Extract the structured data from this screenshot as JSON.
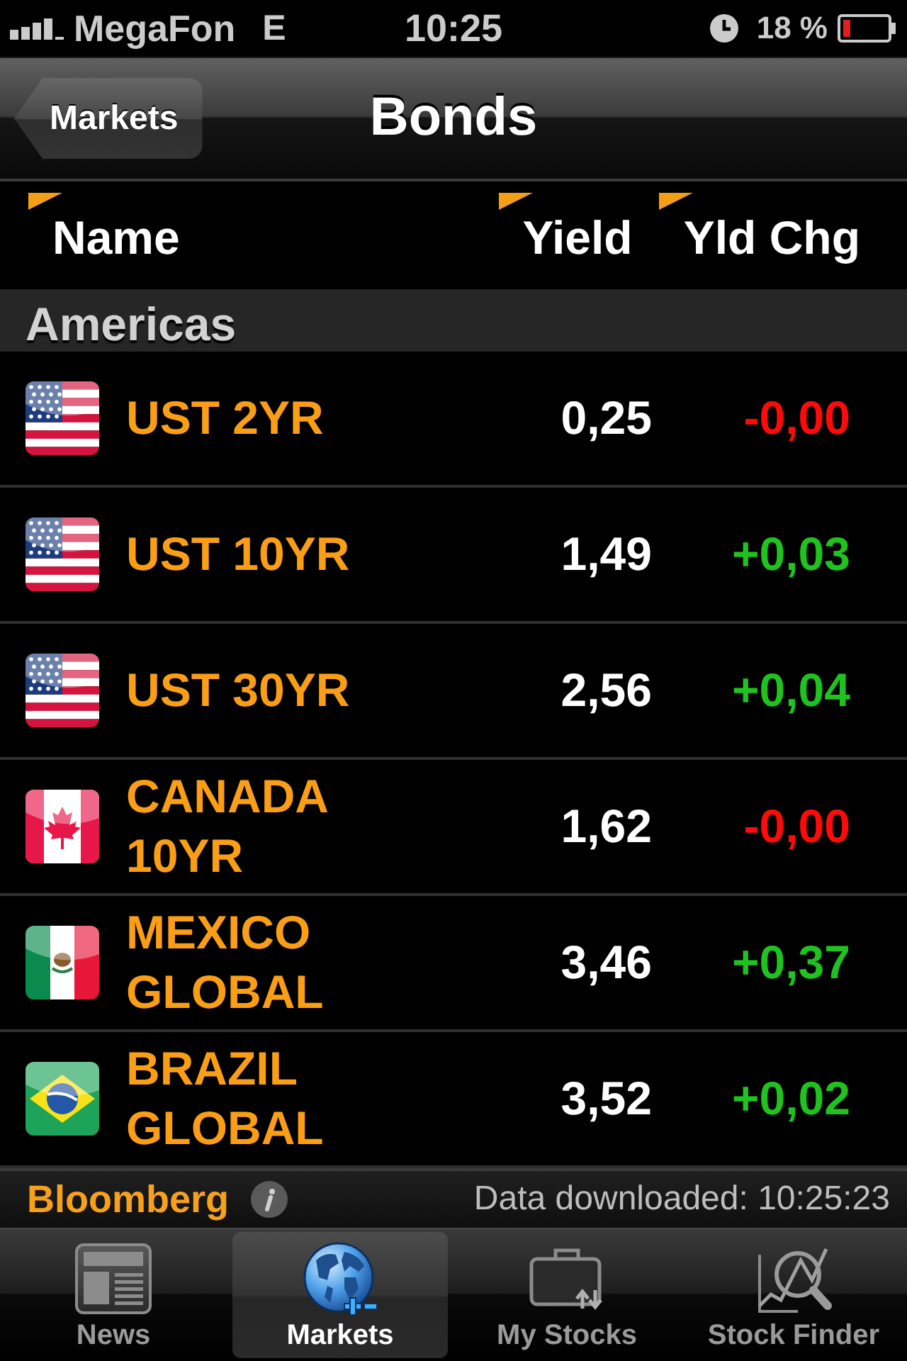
{
  "status_bar": {
    "carrier": "MegaFon",
    "network": "E",
    "time": "10:25",
    "battery": "18 %"
  },
  "nav_bar": {
    "back_button": "Markets",
    "title": "Bonds"
  },
  "table": {
    "columns": [
      "Name",
      "Yield",
      "Yld Chg"
    ],
    "sections": [
      {
        "title": "Americas",
        "rows": [
          {
            "kind": "usa",
            "name": "UST 2YR",
            "yield": "0,25",
            "change": "-0,00",
            "color": "#ff0a0a"
          },
          {
            "kind": "usa",
            "name": "UST 10YR",
            "yield": "1,49",
            "change": "+0,03",
            "color": "#1fc21f"
          },
          {
            "kind": "usa",
            "name": "UST 30YR",
            "yield": "2,56",
            "change": "+0,04",
            "color": "#1fc21f"
          },
          {
            "kind": "canada",
            "name": "CANADA 10YR",
            "yield": "1,62",
            "change": "-0,00",
            "color": "#ff0a0a"
          },
          {
            "kind": "mexico",
            "name": "MEXICO GLOBAL",
            "yield": "3,46",
            "change": "+0,37",
            "color": "#1fc21f"
          },
          {
            "kind": "brazil",
            "name": "BRAZIL GLOBAL",
            "yield": "3,52",
            "change": "+0,02",
            "color": "#1fc21f"
          }
        ]
      }
    ]
  },
  "footer": {
    "brand": "Bloomberg",
    "status": "Data downloaded: 10:25:23"
  },
  "tab_bar": {
    "tabs": [
      {
        "kind": "newspaper",
        "label": "News",
        "selected": false
      },
      {
        "kind": "globe",
        "label": "Markets",
        "selected": true
      },
      {
        "kind": "briefcase",
        "label": "My Stocks",
        "selected": false
      },
      {
        "kind": "finder",
        "label": "Stock Finder",
        "selected": false
      }
    ]
  }
}
